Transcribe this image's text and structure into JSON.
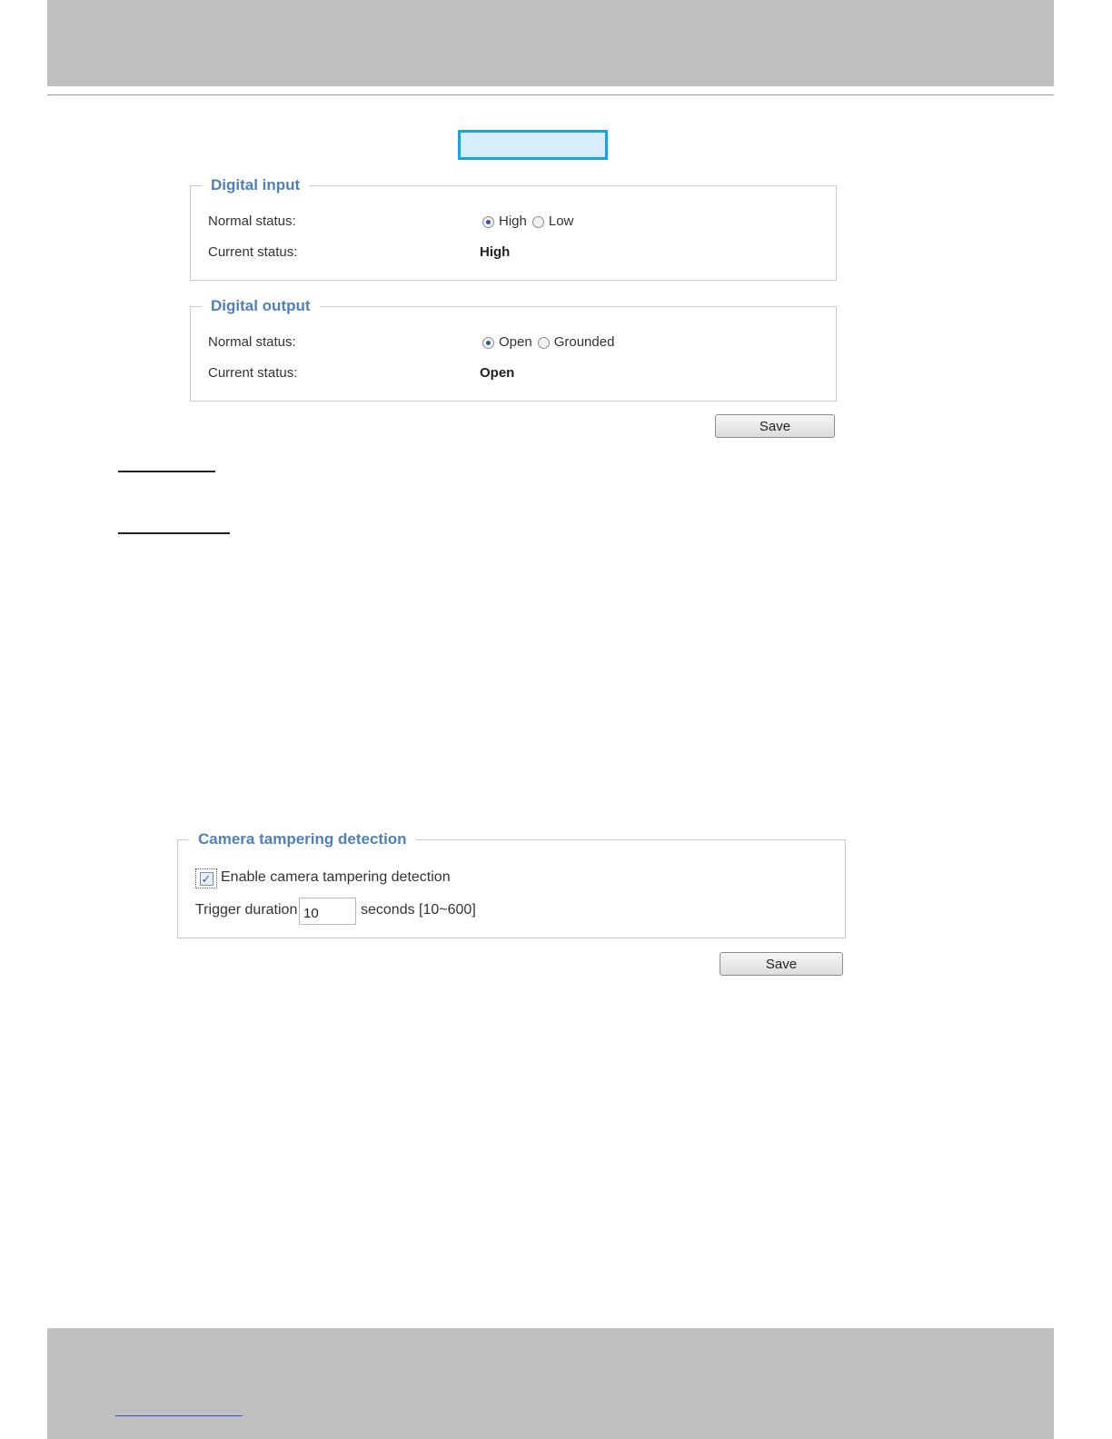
{
  "digital_input": {
    "title": "Digital input",
    "normal_status_label": "Normal status:",
    "options": [
      "High",
      "Low"
    ],
    "selected": "High",
    "current_status_label": "Current status:",
    "current_status_value": "High"
  },
  "digital_output": {
    "title": "Digital output",
    "normal_status_label": "Normal status:",
    "options": [
      "Open",
      "Grounded"
    ],
    "selected": "Open",
    "current_status_label": "Current status:",
    "current_status_value": "Open"
  },
  "save_label": "Save",
  "tampering": {
    "title": "Camera tampering detection",
    "enable_label": "Enable camera tampering detection",
    "enabled": true,
    "trigger_label": "Trigger duration",
    "trigger_value": "10",
    "unit_label": "seconds [10~600]"
  },
  "colors": {
    "legend": "#4f7fbd",
    "highlight_border": "#12a6e8",
    "highlight_fill": "#d7edfc",
    "band": "#c0c0c0"
  }
}
